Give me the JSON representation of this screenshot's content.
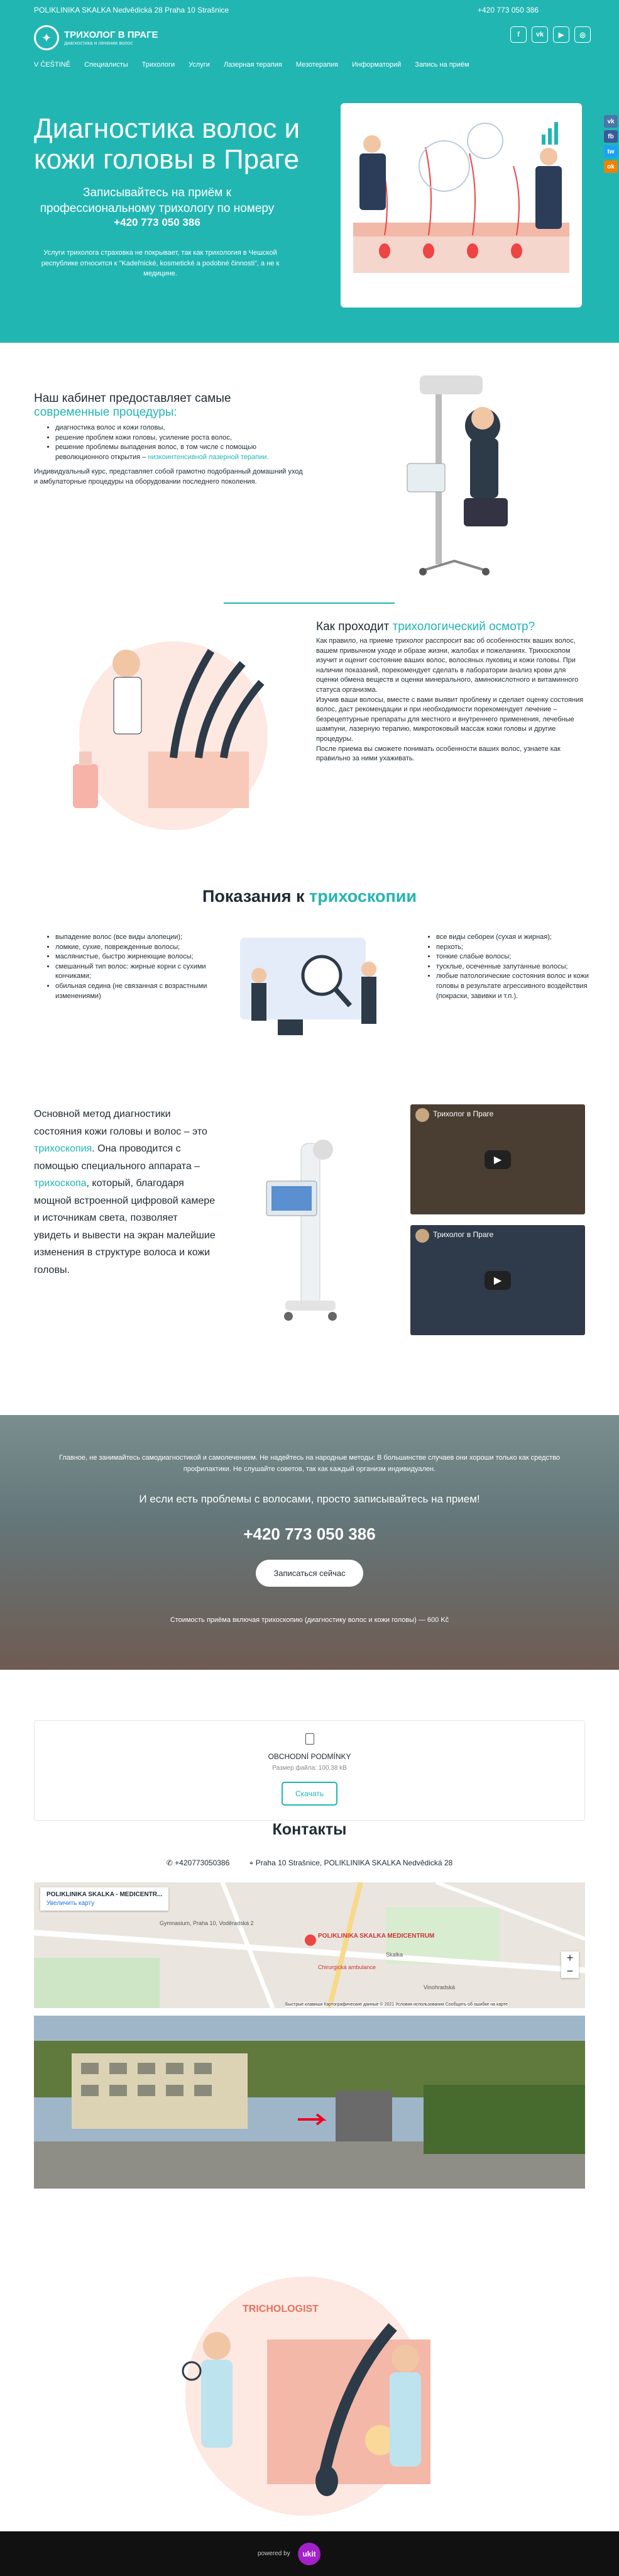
{
  "colors": {
    "accent": "#22b6b3",
    "dark": "#111111"
  },
  "topbar": {
    "address": "POLIKLINIKA SKALKA Nedvědická 28   Praha 10 Strašnice",
    "phone": "+420 773 050 386"
  },
  "brand": {
    "name": "ТРИХОЛОГ В ПРАГЕ",
    "tagline": "диагностика и лечение волос"
  },
  "social": [
    "fb-icon",
    "vk-icon",
    "youtube-icon",
    "instagram-icon"
  ],
  "nav": [
    "V ČEŠTINĚ",
    "Специалисты",
    "Трихологи",
    "Услуги",
    "Лазерная терапия",
    "Мезотерапия",
    "Информаторий",
    "Запись на приём"
  ],
  "hero": {
    "title": "Диагностика волос и кожи головы в Праге",
    "subtitle": "Записывайтесь на приём к профессиональному трихологу по номеру",
    "phone": "+420 773 050 386",
    "note": "Услуги трихолога страховка не покрывает, так как трихология в Чешской республике относится к \"Kadeřnické, kosmetické a podobné činnosti\", а не к медицине."
  },
  "side_share": [
    "vk",
    "fb",
    "tw",
    "ok"
  ],
  "cabinet": {
    "title_a": "Наш кабинет предоставляет самые",
    "title_b": "современные процедуры:",
    "items": [
      "диагностика волос и кожи головы,",
      "решение проблем кожи головы, усиление роста волос,",
      "решение проблемы выпадения волос, в том числе с помощью революционного открытия –",
      "лазерной терапии."
    ],
    "link": "низкоинтенсивной",
    "text": "Индивидуальный курс, представляет собой грамотно подобранный домашний уход и амбулаторные процедуры на оборудовании последнего поколения."
  },
  "exam": {
    "title_a": "Как проходит",
    "title_b": "трихологический осмотр?",
    "p1": "Как правило, на приеме трихолог расспросит вас об особенностях ваших волос, вашем привычном уходе и образе жизни, жалобах и пожеланиях. Трихоскопом изучит и оценит состояние ваших волос, волосяных луковиц и кожи головы. При наличии показаний, порекомендует сделать в лаборатории анализ крови для оценки обмена веществ и оценки минерального, аминокислотного и витаминного статуса организма.",
    "p2": "Изучив ваши волосы, вместе с вами выявит проблему и сделает оценку состояния волос, даст рекомендации и при необходимости порекомендует лечение – безрецептурные препараты для местного и внутреннего применения, лечебные шампуни, лазерную терапию, микротоковый массаж кожи головы и другие процедуры.",
    "p3": "После приема вы сможете понимать особенности ваших волос, узнаете как правильно за ними ухаживать."
  },
  "indications": {
    "title_a": "Показания к",
    "title_b": "трихоскопии",
    "left": [
      "выпадение волос (все виды алопеции);",
      "ломкие, сухие, поврежденные волосы;",
      "маслянистые, быстро жирнеющие волосы;",
      "смешанный тип волос: жирные корни с сухими кончиками;",
      "обильная седина (не связанная с возрастными изменениями)"
    ],
    "right": [
      "все виды себореи (сухая и жирная);",
      "перхоть;",
      "тонкие слабые волосы;",
      "тусклые, осеченные запутанные волосы;",
      "любые патологические состояния волос и кожи головы в результате агрессивного воздействия (покраски, завивки и т.п.)."
    ]
  },
  "method": {
    "text_a": "Основной метод диагностики состояния кожи головы и волос – это",
    "link": "трихоскопия",
    "text_b": ". Она проводится с помощью специального аппарата –",
    "link2": "трихоскопа",
    "text_c": ", который, благодаря мощной встроенной цифровой камере и источникам света, позволяет увидеть и вывести на экран малейшие изменения в структуре волоса и кожи головы."
  },
  "videos": [
    {
      "title": "Трихолог в Праге"
    },
    {
      "title": "Трихолог в Праге"
    }
  ],
  "cta": {
    "text": "Главное, не занимайтесь самодиагностикой и самолечением. Не надейтесь на народные методы: В большинстве случаев они хороши только как средство профилактики. Не слушайте советов, так как каждый организм индивидуален.",
    "headline": "И если есть проблемы с волосами, просто записывайтесь  на прием!",
    "phone": "+420 773 050 386",
    "button": "Записаться сейчас",
    "price": "Стоимость приёма включая трихоскопию (диагностику волос и кожи головы) — 600 Kč"
  },
  "doc": {
    "title": "OBCHODNÍ PODMÍNKY",
    "size": "Размер файла: 100.38 kB",
    "button": "Скачать"
  },
  "contacts": {
    "title": "Контакты",
    "phone": "+420773050386",
    "address": "Praha 10 Strašnice, POLIKLINIKA SKALKA Nedvědická 28"
  },
  "map": {
    "place": "POLIKLINIKA SKALKA - MEDICENTR...",
    "link": "Увеличить карту",
    "labels": [
      "Gymnasium, Praha 10, Voděradská 2",
      "POLIKLINIKA SKALKA MEDICENTRUM",
      "Chirurgická ambulance",
      "Skalka",
      "Vinohradská"
    ],
    "footer": "Быстрые клавиши   Картографические данные © 2021   Условия использования   Сообщить об ошибке на карте"
  },
  "illustration": {
    "label": "TRICHOLOGIST"
  },
  "footer": {
    "powered": "powered by",
    "brand": "ukit"
  }
}
